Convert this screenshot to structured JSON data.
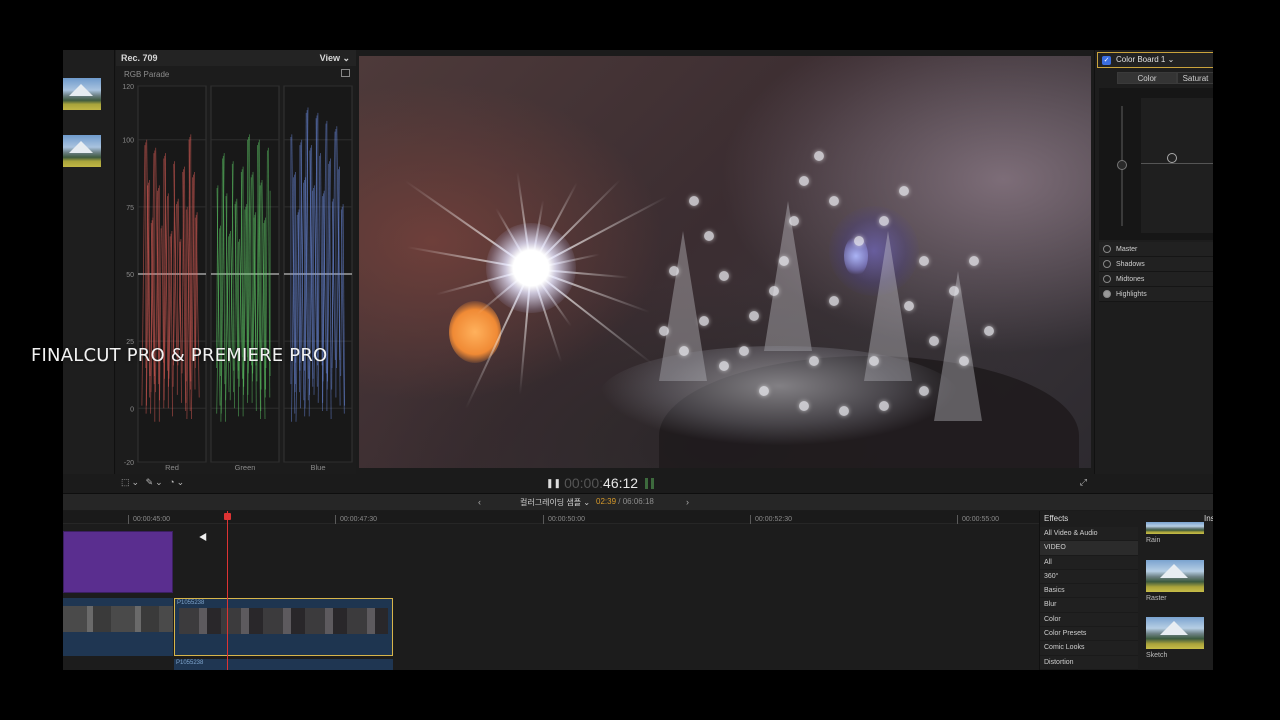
{
  "overlay_caption": "FINALCUT PRO & PREMIERE PRO",
  "scope": {
    "standard": "Rec. 709",
    "view_menu": "View ⌄",
    "type": "RGB Parade",
    "y_ticks": [
      "120",
      "100",
      "75",
      "50",
      "25",
      "0",
      "-20"
    ],
    "channels": [
      {
        "name": "Red",
        "color": "#e8615a"
      },
      {
        "name": "Green",
        "color": "#62d36a"
      },
      {
        "name": "Blue",
        "color": "#6f8fe6"
      }
    ]
  },
  "inspector": {
    "title": "Color Board 1 ⌄",
    "tabs": [
      "Color",
      "Saturat"
    ],
    "tones": [
      "Master",
      "Shadows",
      "Midtones",
      "Highlights"
    ],
    "selected_tone": "Highlights"
  },
  "transport": {
    "timecode_dim": "00:00:",
    "timecode": "46:12",
    "tool_icons": [
      "crop-icon",
      "magic-icon",
      "speed-icon"
    ],
    "tool_glyphs": [
      "⬚⌄",
      "✎⌄",
      "◔⌄"
    ],
    "play_glyph": "❚❚",
    "fullscreen_glyph": "⤢"
  },
  "timeline": {
    "project_name": "컬러그레이딩 샘플 ⌄",
    "position": "02:39",
    "total": " / 06:06:18",
    "ruler_ticks": [
      "00:00:45:00",
      "00:00:47:30",
      "00:00:50:00",
      "00:00:52:30",
      "00:00:55:00"
    ],
    "clip_name": "P1055238",
    "clip_name_lower": "P1055238",
    "nav_left": "‹",
    "nav_right": "›"
  },
  "effects": {
    "title": "Effects",
    "inspector_tab": "Ins",
    "categories": [
      "All Video & Audio",
      "VIDEO",
      "All",
      "360°",
      "Basics",
      "Blur",
      "Color",
      "Color Presets",
      "Comic Looks",
      "Distortion"
    ],
    "selected": "VIDEO",
    "thumbnails": [
      "Rain",
      "Raster",
      "Sketch"
    ]
  }
}
